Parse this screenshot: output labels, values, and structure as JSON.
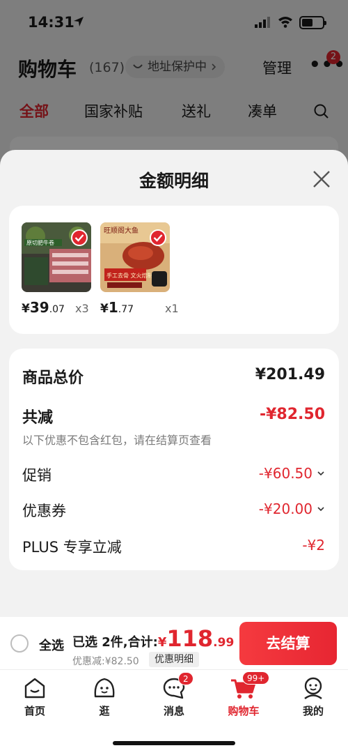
{
  "status": {
    "time": "14:31"
  },
  "cart": {
    "title": "购物车",
    "count": "(167)",
    "address_chip": "地址保护中",
    "manage": "管理",
    "more_badge": "2",
    "tabs": [
      "全部",
      "国家补贴",
      "送礼",
      "凑单"
    ]
  },
  "sheet": {
    "title": "金额明细",
    "items": [
      {
        "price_yen": "¥",
        "price_int": "39",
        "price_dec": ".07",
        "qty": "x3",
        "thumb_text": "原切肥牛卷"
      },
      {
        "price_yen": "¥",
        "price_int": "1",
        "price_dec": ".77",
        "qty": "x1",
        "thumb_text": "旺顺阁大鱼",
        "thumb_banner": "手工去骨 文火焙制"
      }
    ],
    "summary": {
      "goods_total_label": "商品总价",
      "goods_total_value": "¥201.49",
      "reduction_label": "共减",
      "reduction_value": "-¥82.50",
      "note": "以下优惠不包含红包，请在结算页查看",
      "promotion_label": "促销",
      "promotion_value": "-¥60.50",
      "coupon_label": "优惠券",
      "coupon_value": "-¥20.00",
      "plus_label": "PLUS 专享立减",
      "plus_value": "-¥2"
    }
  },
  "checkout": {
    "select_all": "全选",
    "selected_label": "已选 2件,合计:",
    "total_yen": "¥",
    "total_int": "118",
    "total_dec": ".99",
    "saved": "优惠减:¥82.50",
    "detail_chip": "优惠明细",
    "button": "去结算"
  },
  "tabbar": {
    "items": [
      {
        "label": "首页"
      },
      {
        "label": "逛"
      },
      {
        "label": "消息",
        "badge": "2"
      },
      {
        "label": "购物车",
        "badge": "99+"
      },
      {
        "label": "我的"
      }
    ]
  },
  "colors": {
    "accent": "#e0262f",
    "sheet_bg": "#f2f2f2",
    "card_bg": "#ffffff"
  }
}
